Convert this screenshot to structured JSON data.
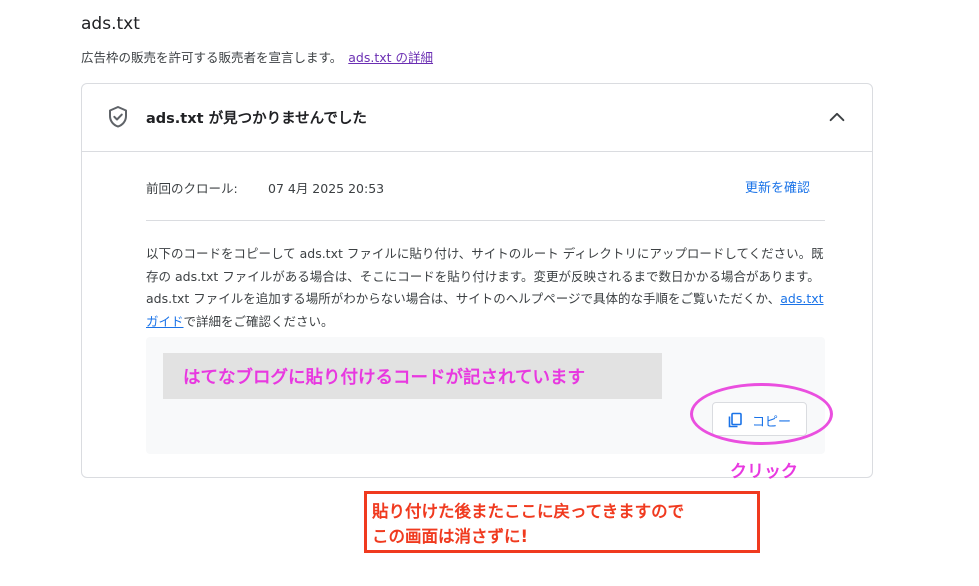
{
  "section": {
    "title": "ads.txt",
    "subtitle": "広告枠の販売を許可する販売者を宣言します。",
    "subtitle_link": "ads.txt の詳細"
  },
  "card": {
    "status_title": "ads.txt が見つかりませんでした",
    "icons": {
      "status": "shield-check-icon",
      "collapse": "chevron-up-icon",
      "copy": "copy-icon"
    },
    "crawl_label": "前回のクロール:",
    "crawl_value": "07 4月 2025 20:53",
    "refresh_link": "更新を確認",
    "description_part1": "以下のコードをコピーして ads.txt ファイルに貼り付け、サイトのルート ディレクトリにアップロードしてください。既存の ads.txt ファイルがある場合は、そこにコードを貼り付けます。変更が反映されるまで数日かかる場合があります。ads.txt ファイルを追加する場所がわからない場合は、サイトのヘルプページで具体的な手順をご覧いただくか、",
    "description_link": "ads.txt ガイド",
    "description_part2": "で詳細をご確認ください。",
    "copy_button": "コピー"
  },
  "annotations": {
    "code_note": "はてなブログに貼り付けるコードが記されています",
    "click_note": "クリック",
    "warning_line1": "貼り付けた後またここに戻ってきますので",
    "warning_line2": "この画面は消さずに!",
    "colors": {
      "annotation_pink": "#e838e0",
      "warning_red": "#f03a1f",
      "link_blue": "#1a73e8"
    }
  }
}
